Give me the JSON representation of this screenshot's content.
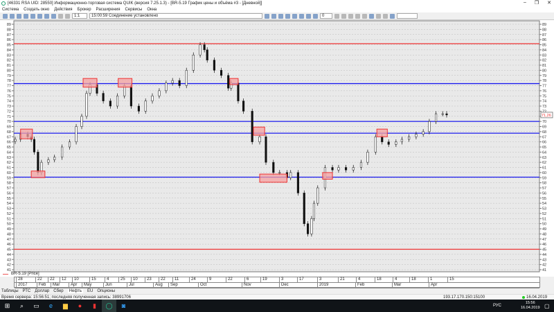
{
  "window": {
    "title": "[46331 RSA UID: 28550] Информационно-торговая система QUIK (версия 7.25.1.3) - [BR-5.19 График цены и объёма #3 - [Дневной]]",
    "controls": [
      "–",
      "❐",
      "✕"
    ]
  },
  "menu": [
    "Система",
    "Создать окно",
    "Действия",
    "Брокер",
    "Расширения",
    "Сервисы",
    "Окна"
  ],
  "toolbar": {
    "ratio": "1:1",
    "connection_time": "15:00:59",
    "connection_status": "Соединение установлено",
    "indicator_value": "0",
    "search_value": ""
  },
  "chart_data": {
    "type": "candlestick",
    "instrument_legend": "BR-5.19 [Price]",
    "ylim": [
      40.6,
      89.5
    ],
    "y_ticks": [
      41,
      42,
      43,
      44,
      45,
      46,
      47,
      48,
      49,
      50,
      51,
      52,
      53,
      54,
      55,
      56,
      57,
      58,
      59,
      60,
      61,
      62,
      63,
      64,
      65,
      66,
      67,
      68,
      69,
      70,
      71,
      72,
      73,
      74,
      75,
      76,
      77,
      78,
      79,
      80,
      81,
      82,
      83,
      84,
      85,
      86,
      87,
      88,
      89
    ],
    "last_price": "71,26",
    "grid": "horizontal dotted",
    "colors": {
      "resistance": "#ee3333",
      "support": "#1a1aee",
      "zone_fill": "#f4a0a0",
      "zone_border": "#ee3333",
      "background": "#e9e9e9"
    },
    "horizontal_lines": [
      {
        "price": 85.2,
        "color": "red"
      },
      {
        "price": 77.4,
        "color": "blue"
      },
      {
        "price": 70.0,
        "color": "blue"
      },
      {
        "price": 67.7,
        "color": "blue"
      },
      {
        "price": 59.1,
        "color": "blue"
      },
      {
        "price": 45.0,
        "color": "red"
      }
    ],
    "zones": [
      {
        "from": "2018-01-06",
        "to": "2018-01-26",
        "low": 66.6,
        "high": 68.5
      },
      {
        "from": "2018-01-24",
        "to": "2018-02-19",
        "low": 59.0,
        "high": 60.3
      },
      {
        "from": "2018-05-04",
        "to": "2018-05-24",
        "low": 76.7,
        "high": 78.4
      },
      {
        "from": "2018-06-21",
        "to": "2018-07-08",
        "low": 76.7,
        "high": 78.4
      },
      {
        "from": "2018-10-24",
        "to": "2018-10-30",
        "low": 77.2,
        "high": 78.4
      },
      {
        "from": "2018-11-11",
        "to": "2018-11-20",
        "low": 67.3,
        "high": 68.9
      },
      {
        "from": "2018-11-16",
        "to": "2018-12-08",
        "low": 58.1,
        "high": 59.7
      },
      {
        "from": "2019-01-06",
        "to": "2019-01-14",
        "low": 58.7,
        "high": 60.0
      },
      {
        "from": "2019-02-18",
        "to": "2019-02-26",
        "low": 67.0,
        "high": 68.5
      }
    ],
    "closes": [
      [
        "2017-12-28",
        66.5
      ],
      [
        "2018-01-06",
        67.5
      ],
      [
        "2018-01-18",
        67
      ],
      [
        "2018-01-24",
        66.5
      ],
      [
        "2018-01-29",
        64
      ],
      [
        "2018-02-05",
        60
      ],
      [
        "2018-02-12",
        62
      ],
      [
        "2018-02-26",
        62.5
      ],
      [
        "2018-03-09",
        63
      ],
      [
        "2018-03-22",
        65
      ],
      [
        "2018-04-05",
        66
      ],
      [
        "2018-04-20",
        69
      ],
      [
        "2018-05-02",
        71
      ],
      [
        "2018-05-09",
        75.5
      ],
      [
        "2018-05-14",
        77.2
      ],
      [
        "2018-05-24",
        75.5
      ],
      [
        "2018-06-02",
        74
      ],
      [
        "2018-06-11",
        73
      ],
      [
        "2018-06-20",
        75
      ],
      [
        "2018-06-29",
        77
      ],
      [
        "2018-07-07",
        73
      ],
      [
        "2018-07-16",
        72
      ],
      [
        "2018-07-24",
        74
      ],
      [
        "2018-08-01",
        75
      ],
      [
        "2018-08-15",
        76
      ],
      [
        "2018-08-29",
        77.5
      ],
      [
        "2018-09-06",
        78
      ],
      [
        "2018-09-13",
        77
      ],
      [
        "2018-09-20",
        80
      ],
      [
        "2018-09-27",
        83
      ],
      [
        "2018-10-03",
        85
      ],
      [
        "2018-10-06",
        84
      ],
      [
        "2018-10-08",
        82
      ],
      [
        "2018-10-13",
        80
      ],
      [
        "2018-10-18",
        79
      ],
      [
        "2018-10-23",
        76.5
      ],
      [
        "2018-10-25",
        77.5
      ],
      [
        "2018-10-30",
        74
      ],
      [
        "2018-11-03",
        72
      ],
      [
        "2018-11-10",
        66
      ],
      [
        "2018-11-16",
        67
      ],
      [
        "2018-11-21",
        62
      ],
      [
        "2018-11-27",
        60
      ],
      [
        "2018-12-02",
        60
      ],
      [
        "2018-12-08",
        59
      ],
      [
        "2018-12-11",
        60
      ],
      [
        "2018-12-17",
        56
      ],
      [
        "2018-12-22",
        50
      ],
      [
        "2018-12-25",
        48
      ],
      [
        "2018-12-28",
        51
      ],
      [
        "2018-12-30",
        54
      ],
      [
        "2019-01-02",
        57
      ],
      [
        "2019-01-08",
        61
      ],
      [
        "2019-01-14",
        60.5
      ],
      [
        "2019-01-19",
        61
      ],
      [
        "2019-01-25",
        60.5
      ],
      [
        "2019-01-31",
        61
      ],
      [
        "2019-02-06",
        62
      ],
      [
        "2019-02-11",
        64
      ],
      [
        "2019-02-17",
        67
      ],
      [
        "2019-02-22",
        66
      ],
      [
        "2019-02-27",
        65.5
      ],
      [
        "2019-03-05",
        66
      ],
      [
        "2019-03-10",
        66.5
      ],
      [
        "2019-03-16",
        67
      ],
      [
        "2019-03-22",
        67.5
      ],
      [
        "2019-03-28",
        68
      ],
      [
        "2019-04-02",
        70
      ],
      [
        "2019-04-07",
        71.5
      ],
      [
        "2019-04-12",
        71.5
      ],
      [
        "2019-04-15",
        71.26
      ]
    ],
    "x_day_ticks": [
      "28",
      "22",
      "22",
      "12",
      "10",
      "15",
      "4",
      "25",
      "10",
      "23",
      "22",
      "11",
      "24",
      "9",
      "22",
      "6",
      "19",
      "3",
      "17",
      "3",
      "21",
      "4",
      "18",
      "4",
      "18",
      "1",
      "15"
    ],
    "x_month_ticks": [
      "2017",
      "Feb",
      "Mar",
      "Apr",
      "May",
      "Jun",
      "Jul",
      "Aug",
      "Sep",
      "Oct",
      "Nov",
      "Dec",
      "2019",
      "Feb",
      "Mar",
      "Apr"
    ]
  },
  "tabs": [
    "Таблицы",
    "РТС",
    "Доллар",
    "Сбер",
    "Нефть",
    "EU",
    "Опционы"
  ],
  "active_tab": "Нефть",
  "status": {
    "text": "Время сервера: 15:56:51; последняя полученная запись: 38991706",
    "server": "193.17.170.150:15100",
    "date": "16.04.2019"
  },
  "taskbar": {
    "lang": "РУС",
    "time": "15:56",
    "date": "16.04.2019"
  }
}
